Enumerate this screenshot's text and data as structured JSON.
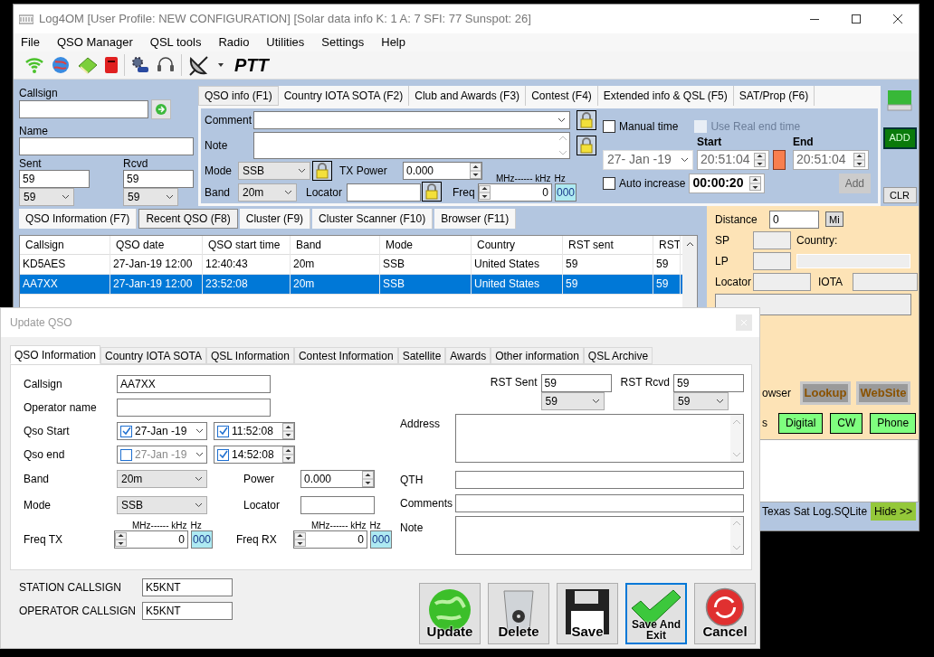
{
  "window": {
    "title": "Log4OM [User Profile: NEW CONFIGURATION] [Solar data info K: 1 A: 7 SFI: 77 Sunspot: 26]"
  },
  "menu": [
    "File",
    "QSO Manager",
    "QSL tools",
    "Radio",
    "Utilities",
    "Settings",
    "Help"
  ],
  "toolbar": {
    "ptt": "PTT"
  },
  "entry": {
    "callsign": {
      "label": "Callsign"
    },
    "name": {
      "label": "Name"
    },
    "sent": {
      "label": "Sent",
      "value": "59",
      "report": "59"
    },
    "rcvd": {
      "label": "Rcvd",
      "value": "59",
      "report": "59"
    }
  },
  "qso_tabs": [
    {
      "label": "QSO info (F1)",
      "selected": true
    },
    {
      "label": "Country IOTA SOTA (F2)",
      "selected": false
    },
    {
      "label": "Club and Awards (F3)",
      "selected": false
    },
    {
      "label": "Contest (F4)",
      "selected": false
    },
    {
      "label": "Extended info & QSL (F5)",
      "selected": false
    },
    {
      "label": "SAT/Prop (F6)",
      "selected": false
    }
  ],
  "qso_info": {
    "comment": {
      "label": "Comment"
    },
    "note": {
      "label": "Note"
    },
    "mode": {
      "label": "Mode",
      "value": "SSB"
    },
    "tx_power": {
      "label": "TX Power",
      "value": "0.000"
    },
    "band": {
      "label": "Band",
      "value": "20m"
    },
    "locator": {
      "label": "Locator"
    },
    "freq": {
      "label": "Freq",
      "units": "MHz------ kHz",
      "hz_label": "Hz",
      "value": "0",
      "hz": "000"
    }
  },
  "timing": {
    "manual_time": {
      "label": "Manual time",
      "checked": false
    },
    "real_end_time": {
      "label": "Use Real end time",
      "checked": false,
      "disabled": true
    },
    "start_label": "Start",
    "end_label": "End",
    "date": "27- Jan -19",
    "start": "20:51:04",
    "end": "20:51:04",
    "auto_increase": {
      "label": "Auto increase",
      "checked": false
    },
    "increment": "00:00:20",
    "add_button": {
      "label": "Add",
      "disabled": true
    }
  },
  "side_buttons": {
    "add": "ADD",
    "clr": "CLR"
  },
  "lower_tabs": [
    {
      "label": "QSO Information (F7)",
      "selected": false
    },
    {
      "label": "Recent QSO (F8)",
      "selected": true
    },
    {
      "label": "Cluster (F9)",
      "selected": false
    },
    {
      "label": "Cluster Scanner (F10)",
      "selected": false
    },
    {
      "label": "Browser (F11)",
      "selected": false
    }
  ],
  "table": {
    "columns": [
      "Callsign",
      "QSO date",
      "QSO start time",
      "Band",
      "Mode",
      "Country",
      "RST sent",
      "RST"
    ],
    "rows": [
      {
        "cells": [
          "KD5AES",
          "27-Jan-19 12:00",
          "12:40:43",
          "20m",
          "SSB",
          "United States",
          "59",
          "59"
        ],
        "selected": false
      },
      {
        "cells": [
          "AA7XX",
          "27-Jan-19 12:00",
          "23:52:08",
          "20m",
          "SSB",
          "United States",
          "59",
          "59"
        ],
        "selected": true
      }
    ]
  },
  "info_panel": {
    "distance": {
      "label": "Distance",
      "value": "0",
      "unit": "Mi"
    },
    "sp_label": "SP",
    "country_label": "Country:",
    "lp_label": "LP",
    "locator_label": "Locator",
    "iota_label": "IOTA",
    "browser_fragment": "owser",
    "lookup": "Lookup",
    "website": "WebSite",
    "modes_fragment": "s",
    "mode_buttons": [
      "Digital",
      "CW",
      "Phone"
    ]
  },
  "status_bar": {
    "database": "Texas Sat Log.SQLite",
    "hide": "Hide >>"
  },
  "dialog": {
    "title": "Update QSO",
    "tabs": [
      {
        "label": "QSO Information",
        "selected": true
      },
      {
        "label": "Country IOTA SOTA",
        "selected": false
      },
      {
        "label": "QSL Information",
        "selected": false
      },
      {
        "label": "Contest Information",
        "selected": false
      },
      {
        "label": "Satellite",
        "selected": false
      },
      {
        "label": "Awards",
        "selected": false
      },
      {
        "label": "Other information",
        "selected": false
      },
      {
        "label": "QSL Archive",
        "selected": false
      }
    ],
    "callsign": {
      "label": "Callsign",
      "value": "AA7XX"
    },
    "operator_name": {
      "label": "Operator name"
    },
    "qso_start": {
      "label": "Qso Start",
      "date": "27-Jan -19",
      "date_checked": true,
      "time": "11:52:08",
      "time_checked": true
    },
    "qso_end": {
      "label": "Qso end",
      "date": "27-Jan -19",
      "date_checked": false,
      "time": "14:52:08",
      "time_checked": true
    },
    "band": {
      "label": "Band",
      "value": "20m"
    },
    "power": {
      "label": "Power",
      "value": "0.000"
    },
    "mode": {
      "label": "Mode",
      "value": "SSB"
    },
    "locator": {
      "label": "Locator"
    },
    "freq_tx": {
      "label": "Freq TX",
      "units": "MHz------ kHz",
      "hz_label": "Hz",
      "value": "0",
      "hz": "000"
    },
    "freq_rx": {
      "label": "Freq RX",
      "units": "MHz------ kHz",
      "hz_label": "Hz",
      "value": "0",
      "hz": "000"
    },
    "rst_sent": {
      "label": "RST Sent",
      "value": "59",
      "report": "59"
    },
    "rst_rcvd": {
      "label": "RST Rcvd",
      "value": "59",
      "report": "59"
    },
    "address": {
      "label": "Address"
    },
    "qth": {
      "label": "QTH"
    },
    "comments": {
      "label": "Comments"
    },
    "note": {
      "label": "Note"
    },
    "station_callsign": {
      "label": "STATION CALLSIGN",
      "value": "K5KNT"
    },
    "operator_callsign": {
      "label": "OPERATOR CALLSIGN",
      "value": "K5KNT"
    },
    "buttons": [
      {
        "label": "Update",
        "kind": "update",
        "focused": false
      },
      {
        "label": "Delete",
        "kind": "delete",
        "focused": false
      },
      {
        "label": "Save",
        "kind": "save",
        "focused": false
      },
      {
        "label": "Save And Exit",
        "kind": "save_exit",
        "focused": true
      },
      {
        "label": "Cancel",
        "kind": "cancel",
        "focused": false
      }
    ]
  }
}
